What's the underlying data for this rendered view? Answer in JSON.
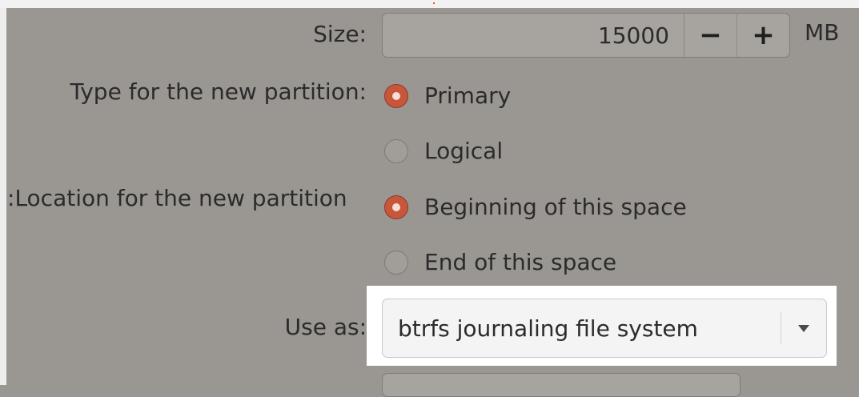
{
  "size": {
    "label": "Size:",
    "value": "15000",
    "minus": "−",
    "plus": "+",
    "unit": "MB"
  },
  "type": {
    "label": "Type for the new partition:",
    "options": [
      {
        "label": "Primary",
        "checked": true
      },
      {
        "label": "Logical",
        "checked": false
      }
    ]
  },
  "location": {
    "label": "Location for the new partition:",
    "options": [
      {
        "label": "Beginning of this space",
        "checked": true
      },
      {
        "label": "End of this space",
        "checked": false
      }
    ]
  },
  "use_as": {
    "label": "Use as:",
    "value": "btrfs journaling file system",
    "icon": "dropdown-arrow-icon"
  },
  "colors": {
    "accent": "#c8563a",
    "dim_background": "#9a9792",
    "highlight": "#ffffff"
  }
}
